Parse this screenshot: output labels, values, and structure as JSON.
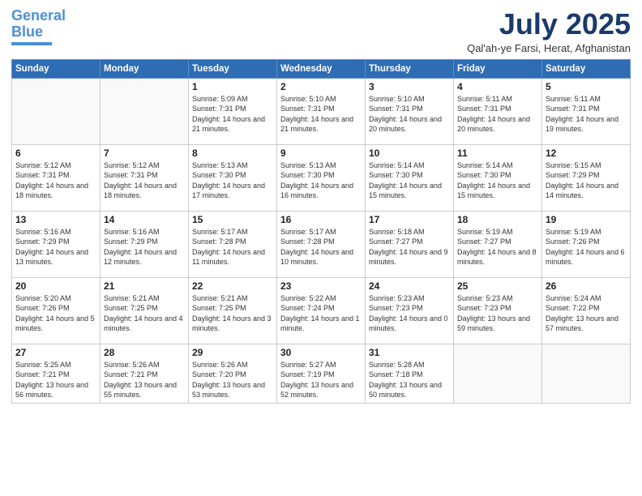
{
  "header": {
    "logo_line1": "General",
    "logo_line2": "Blue",
    "month": "July 2025",
    "location": "Qal'ah-ye Farsi, Herat, Afghanistan"
  },
  "days_of_week": [
    "Sunday",
    "Monday",
    "Tuesday",
    "Wednesday",
    "Thursday",
    "Friday",
    "Saturday"
  ],
  "weeks": [
    [
      {
        "day": "",
        "info": ""
      },
      {
        "day": "",
        "info": ""
      },
      {
        "day": "1",
        "info": "Sunrise: 5:09 AM\nSunset: 7:31 PM\nDaylight: 14 hours and 21 minutes."
      },
      {
        "day": "2",
        "info": "Sunrise: 5:10 AM\nSunset: 7:31 PM\nDaylight: 14 hours and 21 minutes."
      },
      {
        "day": "3",
        "info": "Sunrise: 5:10 AM\nSunset: 7:31 PM\nDaylight: 14 hours and 20 minutes."
      },
      {
        "day": "4",
        "info": "Sunrise: 5:11 AM\nSunset: 7:31 PM\nDaylight: 14 hours and 20 minutes."
      },
      {
        "day": "5",
        "info": "Sunrise: 5:11 AM\nSunset: 7:31 PM\nDaylight: 14 hours and 19 minutes."
      }
    ],
    [
      {
        "day": "6",
        "info": "Sunrise: 5:12 AM\nSunset: 7:31 PM\nDaylight: 14 hours and 18 minutes."
      },
      {
        "day": "7",
        "info": "Sunrise: 5:12 AM\nSunset: 7:31 PM\nDaylight: 14 hours and 18 minutes."
      },
      {
        "day": "8",
        "info": "Sunrise: 5:13 AM\nSunset: 7:30 PM\nDaylight: 14 hours and 17 minutes."
      },
      {
        "day": "9",
        "info": "Sunrise: 5:13 AM\nSunset: 7:30 PM\nDaylight: 14 hours and 16 minutes."
      },
      {
        "day": "10",
        "info": "Sunrise: 5:14 AM\nSunset: 7:30 PM\nDaylight: 14 hours and 15 minutes."
      },
      {
        "day": "11",
        "info": "Sunrise: 5:14 AM\nSunset: 7:30 PM\nDaylight: 14 hours and 15 minutes."
      },
      {
        "day": "12",
        "info": "Sunrise: 5:15 AM\nSunset: 7:29 PM\nDaylight: 14 hours and 14 minutes."
      }
    ],
    [
      {
        "day": "13",
        "info": "Sunrise: 5:16 AM\nSunset: 7:29 PM\nDaylight: 14 hours and 13 minutes."
      },
      {
        "day": "14",
        "info": "Sunrise: 5:16 AM\nSunset: 7:29 PM\nDaylight: 14 hours and 12 minutes."
      },
      {
        "day": "15",
        "info": "Sunrise: 5:17 AM\nSunset: 7:28 PM\nDaylight: 14 hours and 11 minutes."
      },
      {
        "day": "16",
        "info": "Sunrise: 5:17 AM\nSunset: 7:28 PM\nDaylight: 14 hours and 10 minutes."
      },
      {
        "day": "17",
        "info": "Sunrise: 5:18 AM\nSunset: 7:27 PM\nDaylight: 14 hours and 9 minutes."
      },
      {
        "day": "18",
        "info": "Sunrise: 5:19 AM\nSunset: 7:27 PM\nDaylight: 14 hours and 8 minutes."
      },
      {
        "day": "19",
        "info": "Sunrise: 5:19 AM\nSunset: 7:26 PM\nDaylight: 14 hours and 6 minutes."
      }
    ],
    [
      {
        "day": "20",
        "info": "Sunrise: 5:20 AM\nSunset: 7:26 PM\nDaylight: 14 hours and 5 minutes."
      },
      {
        "day": "21",
        "info": "Sunrise: 5:21 AM\nSunset: 7:25 PM\nDaylight: 14 hours and 4 minutes."
      },
      {
        "day": "22",
        "info": "Sunrise: 5:21 AM\nSunset: 7:25 PM\nDaylight: 14 hours and 3 minutes."
      },
      {
        "day": "23",
        "info": "Sunrise: 5:22 AM\nSunset: 7:24 PM\nDaylight: 14 hours and 1 minute."
      },
      {
        "day": "24",
        "info": "Sunrise: 5:23 AM\nSunset: 7:23 PM\nDaylight: 14 hours and 0 minutes."
      },
      {
        "day": "25",
        "info": "Sunrise: 5:23 AM\nSunset: 7:23 PM\nDaylight: 13 hours and 59 minutes."
      },
      {
        "day": "26",
        "info": "Sunrise: 5:24 AM\nSunset: 7:22 PM\nDaylight: 13 hours and 57 minutes."
      }
    ],
    [
      {
        "day": "27",
        "info": "Sunrise: 5:25 AM\nSunset: 7:21 PM\nDaylight: 13 hours and 56 minutes."
      },
      {
        "day": "28",
        "info": "Sunrise: 5:26 AM\nSunset: 7:21 PM\nDaylight: 13 hours and 55 minutes."
      },
      {
        "day": "29",
        "info": "Sunrise: 5:26 AM\nSunset: 7:20 PM\nDaylight: 13 hours and 53 minutes."
      },
      {
        "day": "30",
        "info": "Sunrise: 5:27 AM\nSunset: 7:19 PM\nDaylight: 13 hours and 52 minutes."
      },
      {
        "day": "31",
        "info": "Sunrise: 5:28 AM\nSunset: 7:18 PM\nDaylight: 13 hours and 50 minutes."
      },
      {
        "day": "",
        "info": ""
      },
      {
        "day": "",
        "info": ""
      }
    ]
  ]
}
